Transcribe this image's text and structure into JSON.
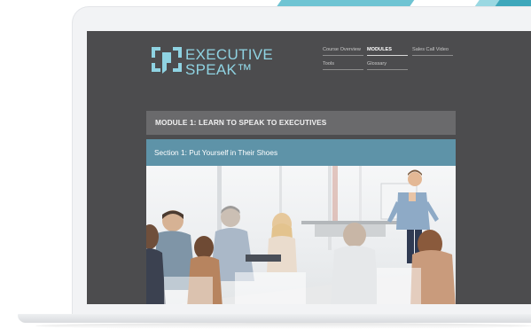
{
  "logo": {
    "line1": "EXECUTIVE",
    "line2": "SPEAK™"
  },
  "nav": {
    "items": [
      {
        "label": "Course Overview",
        "active": false
      },
      {
        "label": "MODULES",
        "active": true
      },
      {
        "label": "Sales Call Video",
        "active": false
      },
      {
        "label": "Tools",
        "active": false
      },
      {
        "label": "Glossary",
        "active": false
      }
    ]
  },
  "module": {
    "title": "MODULE 1: LEARN TO SPEAK TO EXECUTIVES"
  },
  "section": {
    "title": "Section 1: Put Yourself in Their Shoes"
  },
  "colors": {
    "accent": "#8fd3e2",
    "section_bar": "#5e93a8",
    "screen_bg": "#4c4c4e",
    "module_bar": "#6a6a6c"
  }
}
